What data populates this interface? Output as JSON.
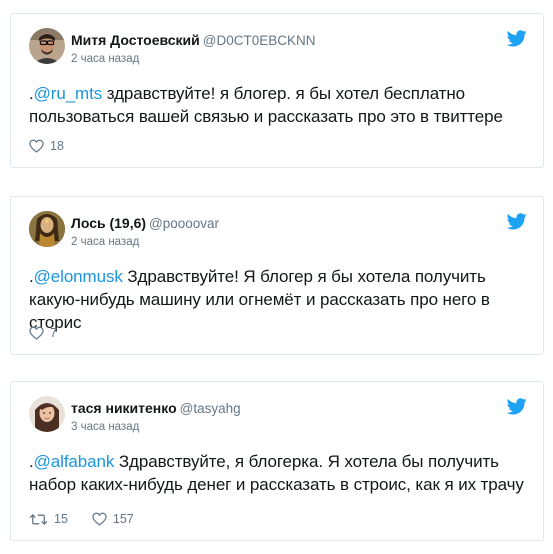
{
  "tweets": [
    {
      "name": "Митя Достоевский",
      "handle": "@D0CT0EBCKNN",
      "time": "2 часа назад",
      "prefix": ".",
      "mention": "@ru_mts",
      "text": " здравствуйте! я блогер. я бы хотел бесплатно пользоваться вашей связью и рассказать про это в твиттере",
      "likes": "18"
    },
    {
      "name": "Лось (19,6)",
      "handle": "@poooovar",
      "time": "2 часа назад",
      "prefix": ".",
      "mention": "@elonmusk",
      "text": " Здравствуйте! Я блогер я бы хотела получить какую-нибудь машину или огнемёт и рассказать про него в сторис",
      "likes": "7"
    },
    {
      "name": "тася никитенко",
      "handle": "@tasyahg",
      "time": "3 часа назад",
      "prefix": ".",
      "mention": "@alfabank",
      "text": " Здравствуйте, я блогерка. Я хотела бы получить набор каких-нибудь денег и рассказать в строис, как я их трачу",
      "retweets": "15",
      "likes": "157"
    }
  ],
  "icons": {
    "brand": "twitter-bird-icon",
    "like": "heart-icon",
    "retweet": "retweet-icon"
  },
  "colors": {
    "twitter_blue": "#1da1f2",
    "mention": "#1b95e0",
    "muted": "#657786",
    "border": "#e1e8ed"
  }
}
